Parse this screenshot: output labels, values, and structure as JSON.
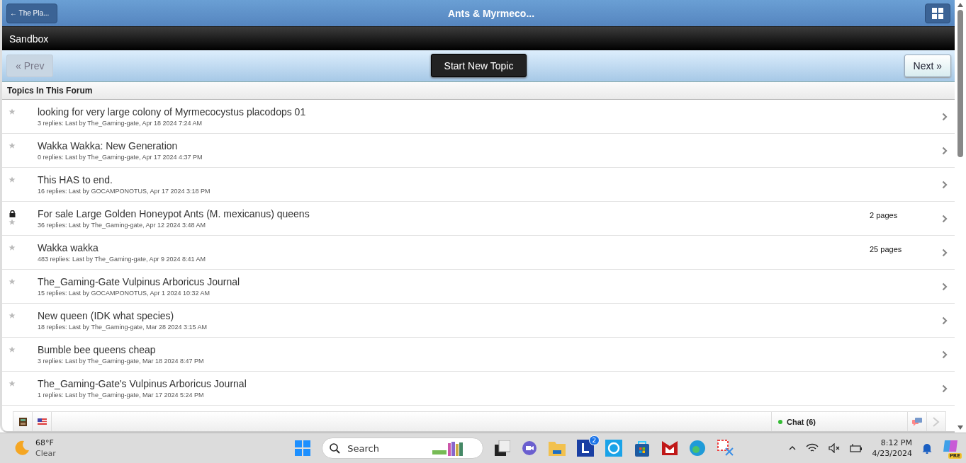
{
  "header": {
    "back_button": "← The Pla...",
    "title": "Ants & Myrmeco..."
  },
  "forum_bar": {
    "title": "Sandbox"
  },
  "toolbar": {
    "prev": {
      "label": "« Prev",
      "disabled": true
    },
    "new_topic": "Start New Topic",
    "next": {
      "label": "Next »",
      "disabled": false
    }
  },
  "section_title": "Topics In This Forum",
  "topics": [
    {
      "title": "looking for very large colony of Myrmecocystus placodops 01",
      "meta": "3 replies: Last by The_Gaming-gate, Apr 18 2024 7:24 AM",
      "locked": false
    },
    {
      "title": "Wakka Wakka: New Generation",
      "meta": "0 replies: Last by The_Gaming-gate, Apr 17 2024 4:37 PM",
      "locked": false
    },
    {
      "title": "This HAS to end.",
      "meta": "16 replies: Last by GOCAMPONOTUS, Apr 17 2024 3:18 PM",
      "locked": false
    },
    {
      "title": "For sale Large Golden Honeypot Ants (M. mexicanus) queens",
      "meta": "36 replies: Last by The_Gaming-gate, Apr 12 2024 3:48 AM",
      "locked": true,
      "pages": "2 pages"
    },
    {
      "title": "Wakka wakka",
      "meta": "483 replies: Last by The_Gaming-gate, Apr 9 2024 8:41 AM",
      "locked": false,
      "pages": "25 pages"
    },
    {
      "title": "The_Gaming-Gate Vulpinus Arboricus Journal",
      "meta": "15 replies: Last by GOCAMPONOTUS, Apr 1 2024 10:32 AM",
      "locked": false
    },
    {
      "title": "New queen (IDK what species)",
      "meta": "18 replies: Last by The_Gaming-gate, Mar 28 2024 3:15 AM",
      "locked": false
    },
    {
      "title": "Bumble bee queens cheap",
      "meta": "3 replies: Last by The_Gaming-gate, Mar 18 2024 8:47 PM",
      "locked": false
    },
    {
      "title": "The_Gaming-Gate's Vulpinus Arboricus Journal",
      "meta": "1 replies: Last by The_Gaming-gate, Mar 17 2024 5:24 PM",
      "locked": false
    }
  ],
  "chat_bar": {
    "chat": "Chat (6)"
  },
  "taskbar": {
    "weather": {
      "temp": "68°F",
      "condition": "Clear"
    },
    "search": {
      "placeholder": "Search"
    },
    "badge": "2",
    "copilot_tag": "PRE",
    "time": "8:12 PM",
    "date": "4/23/2024"
  }
}
